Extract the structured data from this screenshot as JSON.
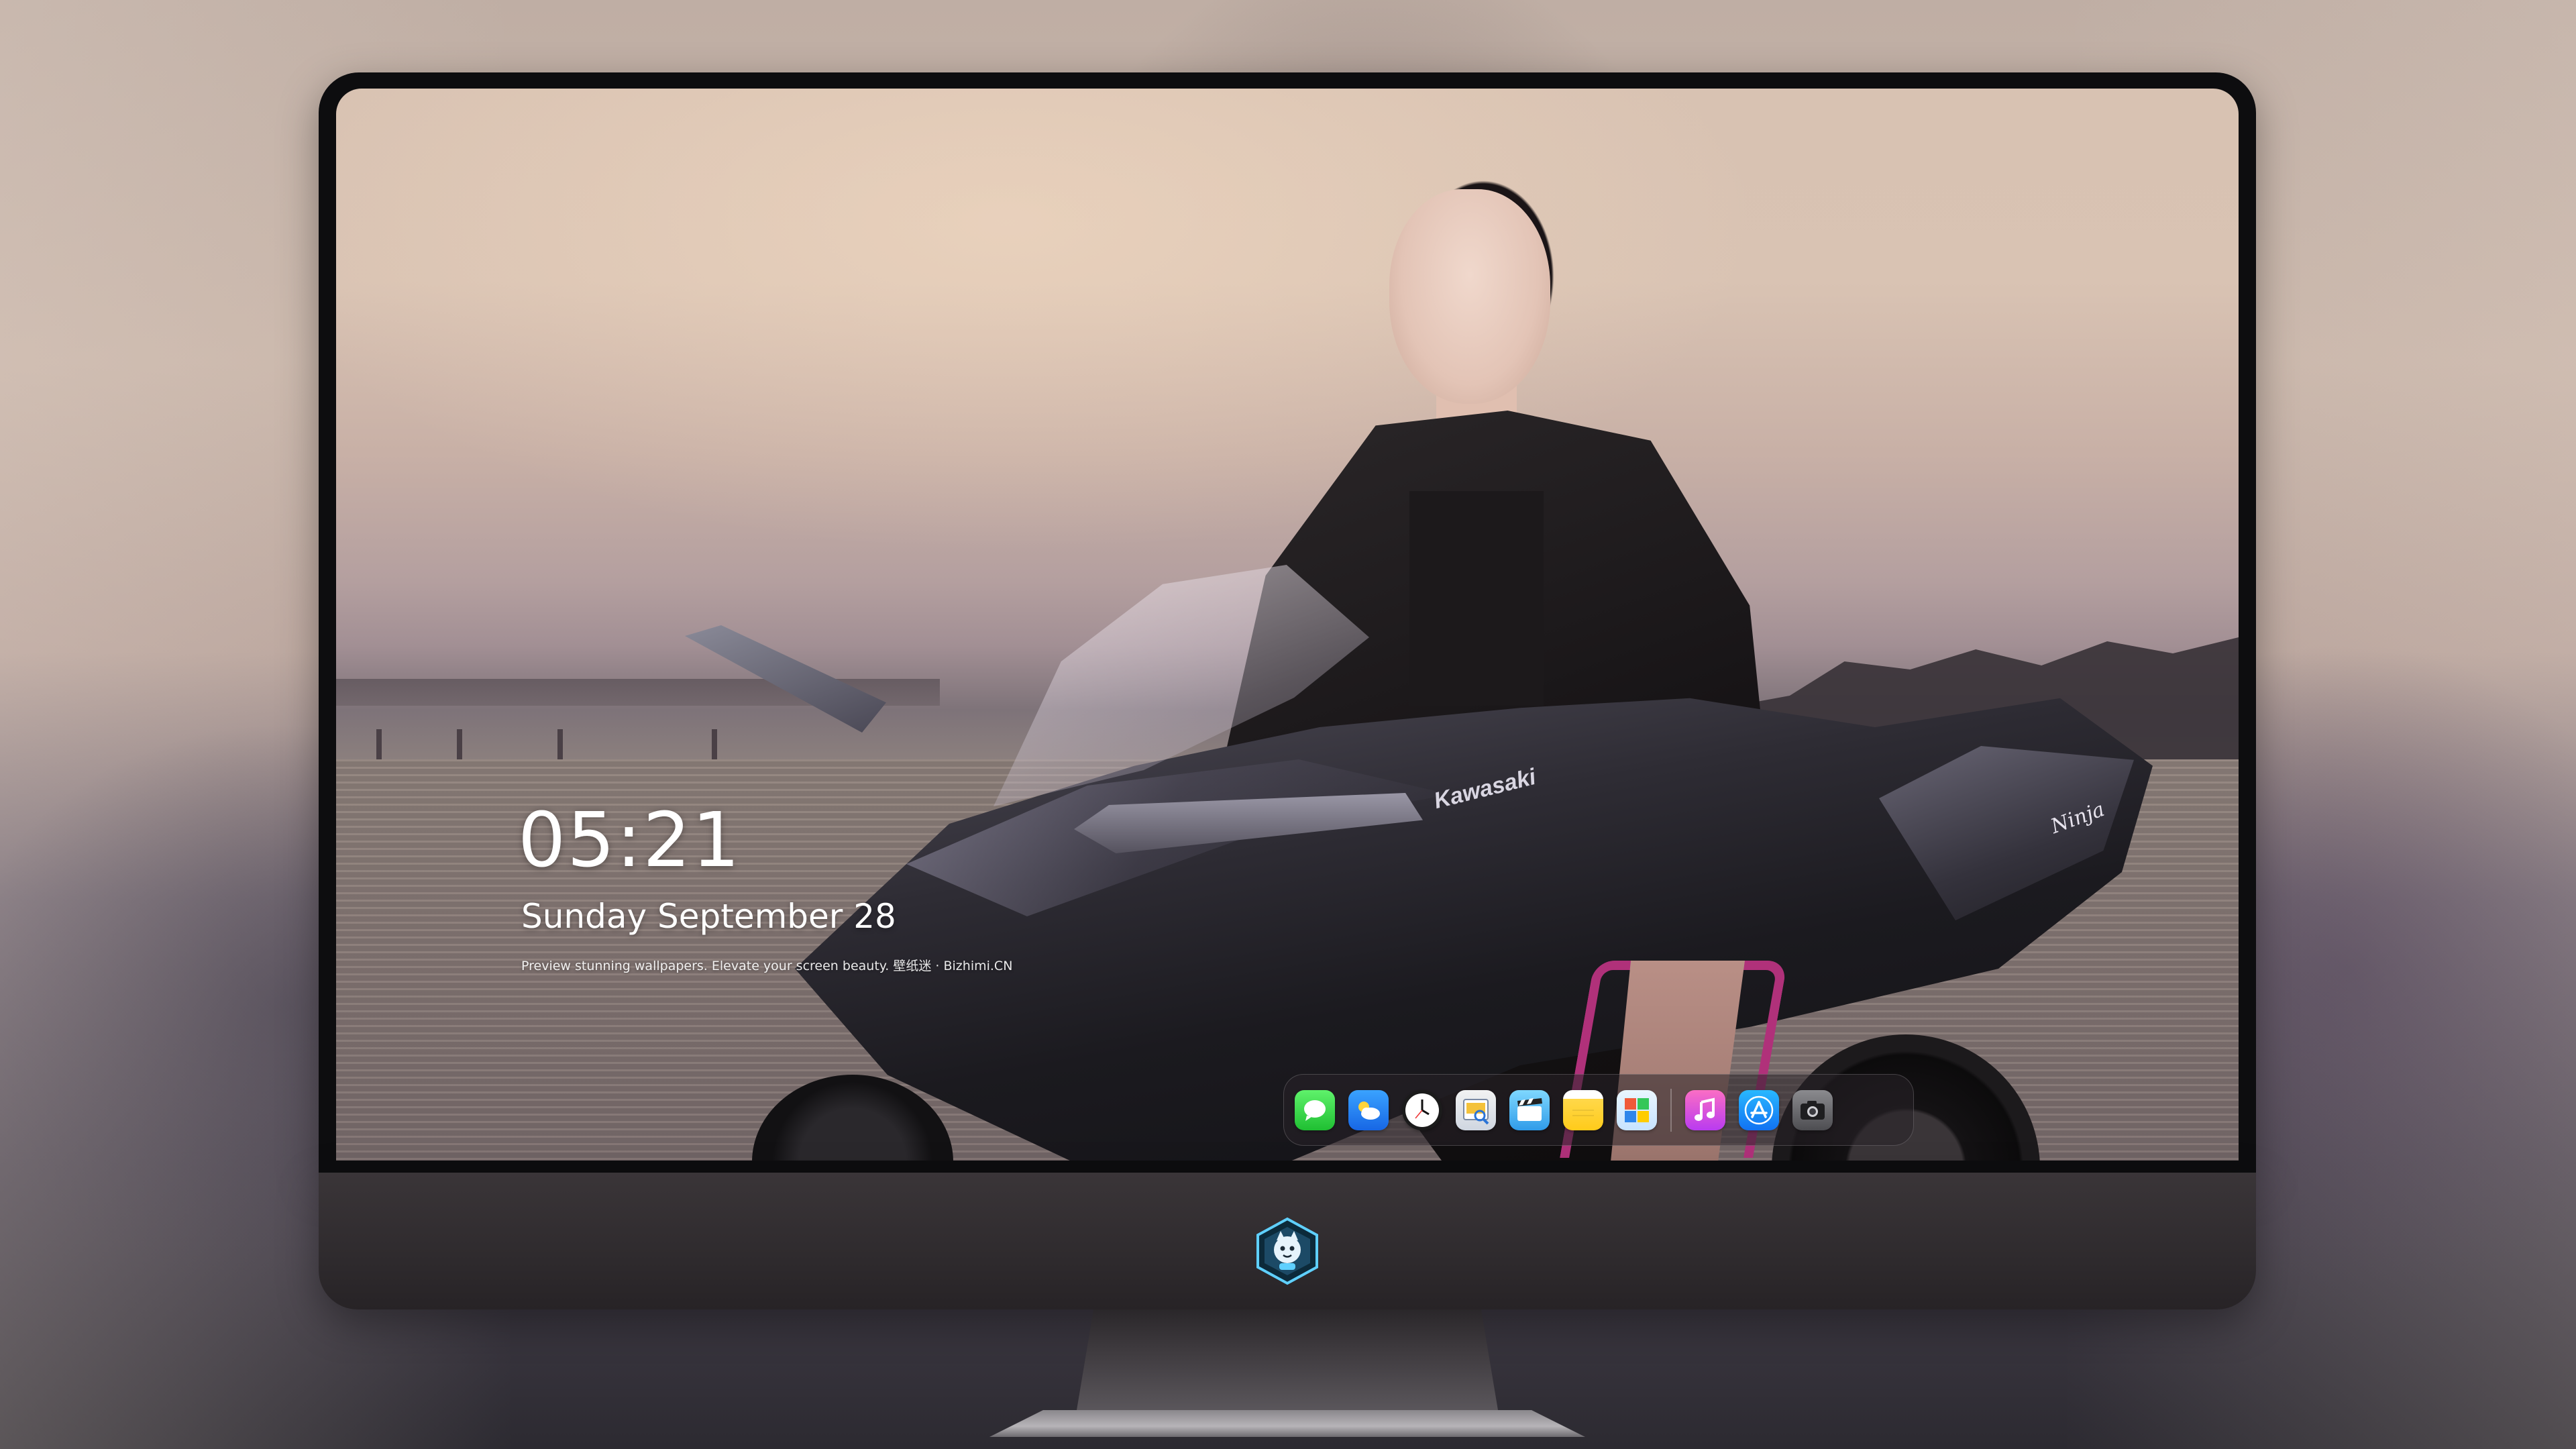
{
  "lock_screen": {
    "time": "05:21",
    "date": "Sunday September 28",
    "caption": "Preview stunning wallpapers. Elevate your screen beauty. 壁纸迷 · Bizhimi.CN"
  },
  "wallpaper": {
    "bike_brand": "Kawasaki",
    "bike_model": "Ninja"
  },
  "dock": {
    "items": [
      {
        "name": "messages",
        "icon": "messages-icon"
      },
      {
        "name": "weather",
        "icon": "weather-icon"
      },
      {
        "name": "clock",
        "icon": "clock-icon"
      },
      {
        "name": "preview",
        "icon": "preview-icon"
      },
      {
        "name": "clips",
        "icon": "clips-icon"
      },
      {
        "name": "notes",
        "icon": "notes-icon"
      },
      {
        "name": "photo-booth",
        "icon": "photo-booth-icon"
      },
      {
        "name": "music",
        "icon": "music-icon"
      },
      {
        "name": "app-store",
        "icon": "app-store-icon"
      },
      {
        "name": "camera",
        "icon": "camera-icon"
      }
    ]
  },
  "colors": {
    "dock_background": "#282328",
    "monitor_chin": "#2f2b2e",
    "bezel": "#0d0d0f",
    "frame_accent": "#b0317a"
  }
}
